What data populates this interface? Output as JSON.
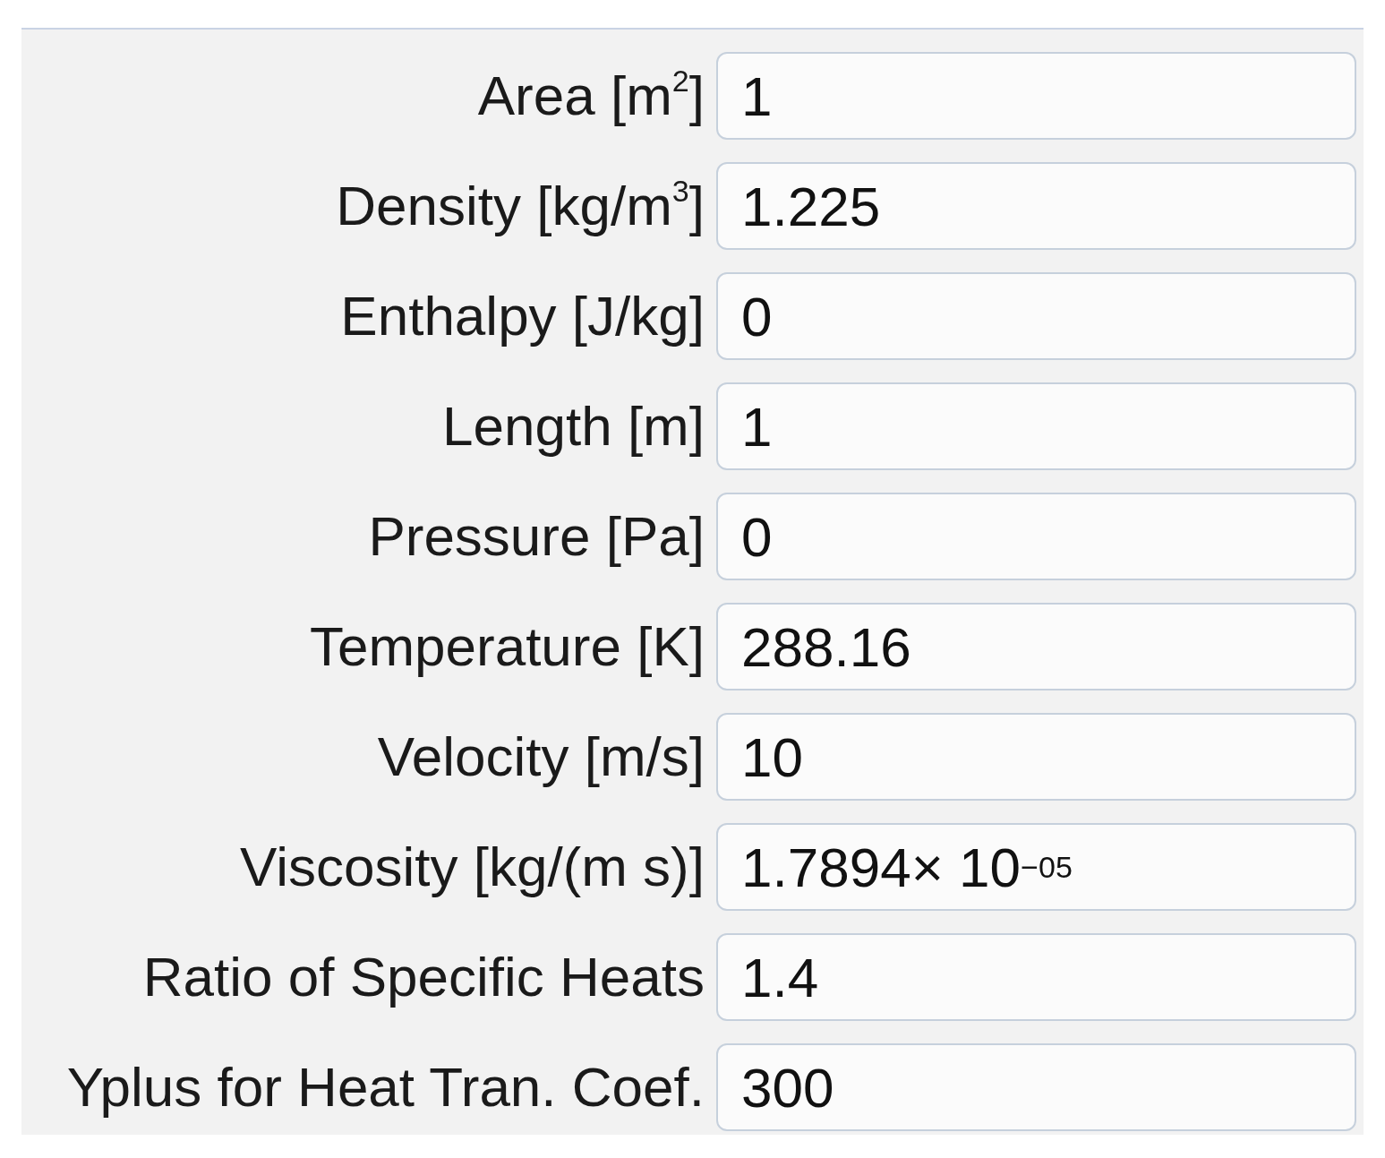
{
  "fields": [
    {
      "label": "Area [m$^{2}$]",
      "value": "1"
    },
    {
      "label": "Density [kg/m$^{3}$]",
      "value": "1.225"
    },
    {
      "label": "Enthalpy [J/kg]",
      "value": "0"
    },
    {
      "label": "Length [m]",
      "value": "1"
    },
    {
      "label": "Pressure [Pa]",
      "value": "0"
    },
    {
      "label": "Temperature [K]",
      "value": "288.16"
    },
    {
      "label": "Velocity [m/s]",
      "value": "10"
    },
    {
      "label": "Viscosity [kg/(m s)]",
      "value": "1.7894× 10$^{−05}$"
    },
    {
      "label": "Ratio of Specific Heats",
      "value": "1.4"
    },
    {
      "label": "Yplus for Heat Tran. Coef.",
      "value": "300"
    }
  ]
}
